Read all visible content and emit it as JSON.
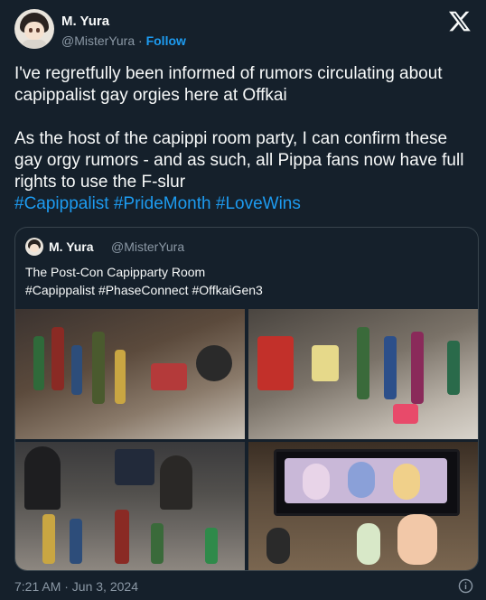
{
  "author": {
    "name": "M. Yura",
    "handle": "@MisterYura",
    "follow_label": "Follow"
  },
  "separator": "·",
  "tweet": {
    "line1": "I've regretfully been informed of rumors circulating about capippalist gay orgies here at Offkai",
    "line2": "As the host of the capippi room party, I can confirm these gay orgy rumors - and as such, all Pippa fans now have full rights to use the F-slur",
    "hashtags": [
      "#Capippalist",
      "#PrideMonth",
      "#LoveWins"
    ]
  },
  "quoted": {
    "name": "M. Yura",
    "handle": "@MisterYura",
    "text_line1": "The Post-Con Capipparty Room",
    "text_line2": "#Capippalist #PhaseConnect #OffkaiGen3",
    "photos": [
      "party-table-bottles",
      "party-table-cups",
      "party-crowd",
      "party-tv-figures"
    ]
  },
  "timestamp": "7:21 AM · Jun 3, 2024",
  "colors": {
    "background": "#15202b",
    "accent": "#1d9bf0",
    "muted": "#8b98a5",
    "border": "#38444d"
  },
  "icons": {
    "brand": "x-logo-icon",
    "info": "info-icon"
  }
}
